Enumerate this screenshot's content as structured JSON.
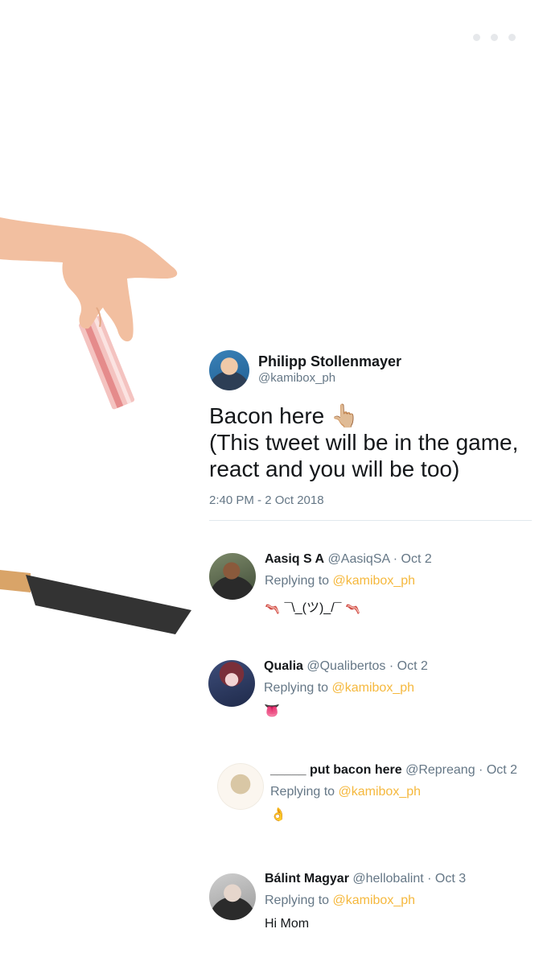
{
  "menu": {
    "icon": "more-dots-icon"
  },
  "illustrations": {
    "hand": "pointing-hand-holding-bacon",
    "knife": "knife-blade"
  },
  "main_tweet": {
    "name": "Philipp Stollenmayer",
    "handle": "@kamibox_ph",
    "text_line1": "Bacon here",
    "text_emoji": "👆🏼",
    "text_line2": "(This tweet will be in the game,",
    "text_line3": "react and you will be too)",
    "time": "2:40 PM - 2 Oct 2018"
  },
  "replies": [
    {
      "name": "Aasiq S A",
      "handle": "@AasiqSA",
      "date": "· Oct 2",
      "replying_label": "Replying to",
      "mention": "@kamibox_ph",
      "body": "¯\\_(ツ)_/¯"
    },
    {
      "name": "Qualia",
      "handle": "@Qualibertos",
      "date": "· Oct 2",
      "replying_label": "Replying to",
      "mention": "@kamibox_ph",
      "body": "👅"
    },
    {
      "name": "_____ put bacon here",
      "handle": "@Repreang",
      "date": "· Oct 2",
      "replying_label": "Replying to",
      "mention": "@kamibox_ph",
      "body": "👌"
    },
    {
      "name": "Bálint Magyar",
      "handle": "@hellobalint",
      "date": "· Oct 3",
      "replying_label": "Replying to",
      "mention": "@kamibox_ph",
      "body": "Hi Mom"
    }
  ],
  "colors": {
    "mention": "#f5b83d",
    "secondary_text": "#657786",
    "skin": "#f2bfa0",
    "bacon": "#e79c9a",
    "knife_blade": "#333333",
    "knife_handle": "#d9a468"
  }
}
